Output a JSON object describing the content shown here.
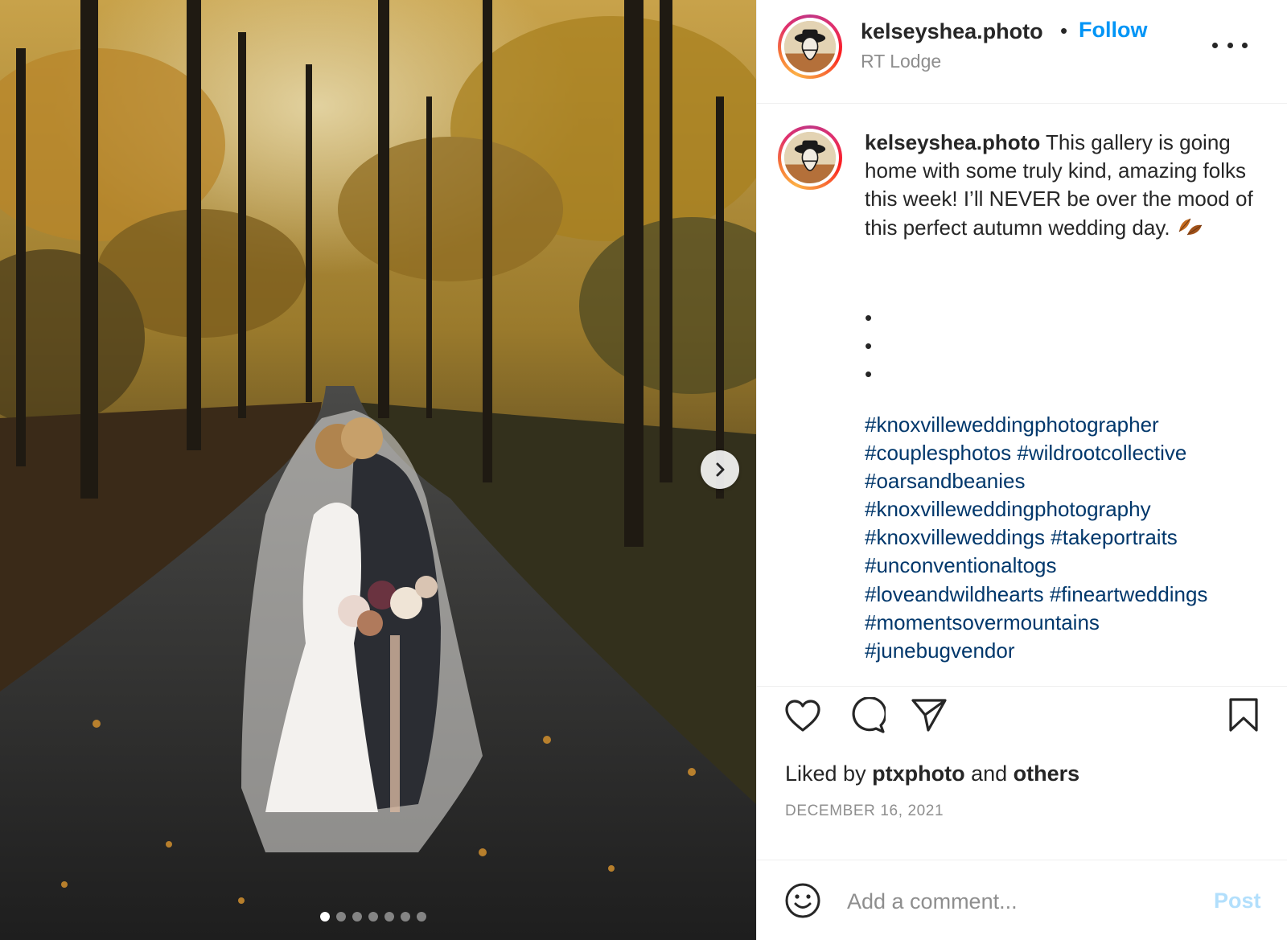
{
  "post": {
    "username": "kelseyshea.photo",
    "follow_label": "Follow",
    "separator": "•",
    "location": "RT Lodge",
    "more_icon": "more-horizontal-icon",
    "carousel": {
      "slide_count": 7,
      "active_index": 0,
      "next_icon": "chevron-right-icon"
    }
  },
  "caption": {
    "username": "kelseyshea.photo",
    "text": "This gallery is going home with some truly kind, amazing folks this week! I’ll NEVER be over the mood of this perfect autumn wedding day.",
    "emoji_icon": "fallen-leaf-icon",
    "dots": [
      "•",
      "•",
      "•"
    ],
    "hashtags": [
      "#knoxvilleweddingphotographer",
      "#couplesphotos",
      "#wildrootcollective",
      "#oarsandbeanies",
      "#knoxvilleweddingphotography",
      "#knoxvilleweddings",
      "#takeportraits",
      "#unconventionaltogs",
      "#loveandwildhearts",
      "#fineartweddings",
      "#momentsovermountains",
      "#junebugvendor"
    ]
  },
  "actions": {
    "icons": [
      "heart-icon",
      "comment-icon",
      "share-icon",
      "bookmark-icon"
    ],
    "liked_by_prefix": "Liked by",
    "liked_by_user": "ptxphoto",
    "liked_by_conj": "and",
    "liked_by_others": "others",
    "date": "DECEMBER 16, 2021"
  },
  "comment": {
    "placeholder": "Add a comment...",
    "post_label": "Post",
    "emoji_icon": "smiley-icon"
  },
  "colors": {
    "link_blue": "#0095f6",
    "hashtag": "#00376b",
    "muted": "#8e8e8e",
    "post_disabled": "#b2dffc",
    "text": "#262626"
  }
}
